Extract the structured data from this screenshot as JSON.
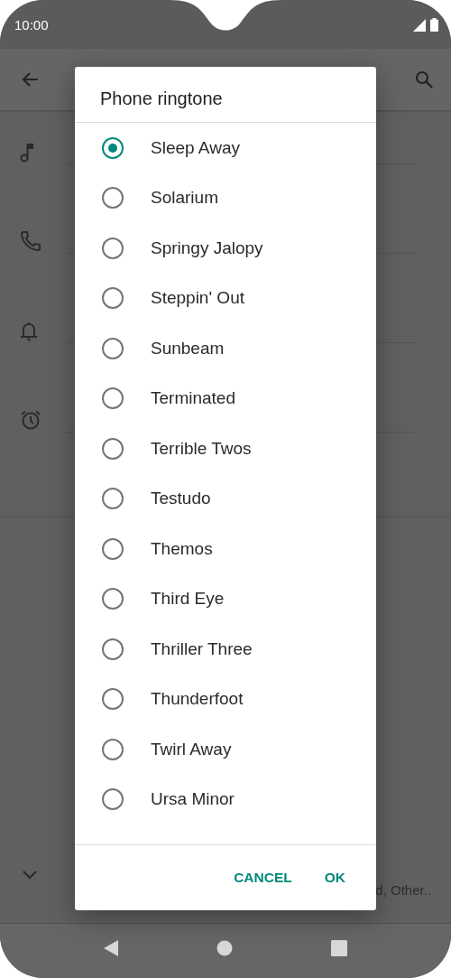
{
  "status_bar": {
    "time": "10:00"
  },
  "dialog": {
    "title": "Phone ringtone",
    "options": [
      {
        "label": "Sleep Away",
        "selected": true
      },
      {
        "label": "Solarium",
        "selected": false
      },
      {
        "label": "Springy Jalopy",
        "selected": false
      },
      {
        "label": "Steppin' Out",
        "selected": false
      },
      {
        "label": "Sunbeam",
        "selected": false
      },
      {
        "label": "Terminated",
        "selected": false
      },
      {
        "label": "Terrible Twos",
        "selected": false
      },
      {
        "label": "Testudo",
        "selected": false
      },
      {
        "label": "Themos",
        "selected": false
      },
      {
        "label": "Third Eye",
        "selected": false
      },
      {
        "label": "Thriller Three",
        "selected": false
      },
      {
        "label": "Thunderfoot",
        "selected": false
      },
      {
        "label": "Twirl Away",
        "selected": false
      },
      {
        "label": "Ursa Minor",
        "selected": false
      }
    ],
    "buttons": [
      "CANCEL",
      "OK"
    ]
  },
  "background": {
    "summary_text": "d, Other.."
  }
}
